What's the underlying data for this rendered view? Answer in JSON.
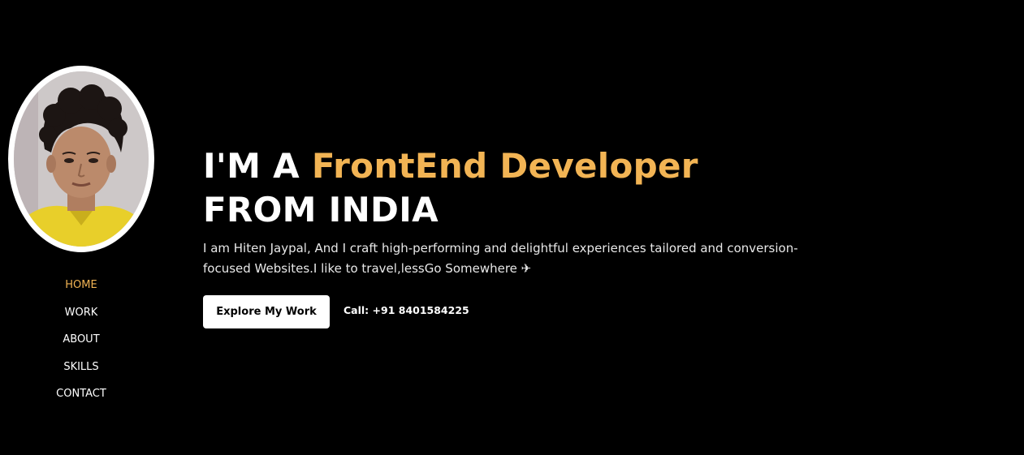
{
  "nav": {
    "items": [
      {
        "label": "HOME",
        "active": true
      },
      {
        "label": "WORK",
        "active": false
      },
      {
        "label": "ABOUT",
        "active": false
      },
      {
        "label": "SKILLS",
        "active": false
      },
      {
        "label": "CONTACT",
        "active": false
      }
    ]
  },
  "hero": {
    "headline_prefix": "I'M A ",
    "headline_accent": "FrontEnd Developer",
    "headline_suffix": " FROM INDIA",
    "intro": "I am Hiten Jaypal, And I craft high-performing and delightful experiences tailored and conversion-focused Websites.I like to travel,lessGo Somewhere ✈",
    "cta_label": "Explore My Work",
    "call_text": "Call: +91 8401584225"
  },
  "colors": {
    "background": "#000000",
    "accent": "#f2b454",
    "text": "#ffffff"
  }
}
